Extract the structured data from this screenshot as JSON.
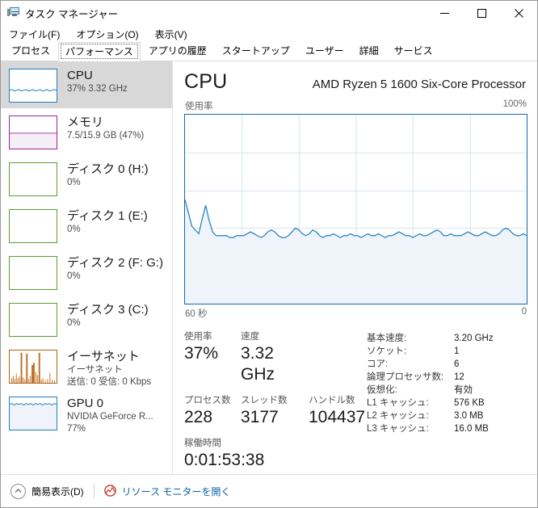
{
  "window": {
    "title": "タスク マネージャー",
    "icon": "task-manager-icon",
    "controls": {
      "minimize": "–",
      "maximize": "☐",
      "close": "✕"
    }
  },
  "menu": [
    {
      "label": "ファイル(F)",
      "name": "menu-file"
    },
    {
      "label": "オプション(O)",
      "name": "menu-options"
    },
    {
      "label": "表示(V)",
      "name": "menu-view"
    }
  ],
  "tabs": [
    {
      "label": "プロセス",
      "selected": false
    },
    {
      "label": "パフォーマンス",
      "selected": true
    },
    {
      "label": "アプリの履歴",
      "selected": false
    },
    {
      "label": "スタートアップ",
      "selected": false
    },
    {
      "label": "ユーザー",
      "selected": false
    },
    {
      "label": "詳細",
      "selected": false
    },
    {
      "label": "サービス",
      "selected": false
    }
  ],
  "sidebar": {
    "items": [
      {
        "title": "CPU",
        "sub1": "37%  3.32 GHz",
        "sub2": "",
        "selected": true,
        "color": "#1f7dc0"
      },
      {
        "title": "メモリ",
        "sub1": "7.5/15.9 GB (47%)",
        "sub2": "",
        "selected": false,
        "color": "#a020a0"
      },
      {
        "title": "ディスク 0 (H:)",
        "sub1": "0%",
        "sub2": "",
        "selected": false,
        "color": "#5a9e2f"
      },
      {
        "title": "ディスク 1 (E:)",
        "sub1": "0%",
        "sub2": "",
        "selected": false,
        "color": "#5a9e2f"
      },
      {
        "title": "ディスク 2 (F: G:)",
        "sub1": "0%",
        "sub2": "",
        "selected": false,
        "color": "#5a9e2f"
      },
      {
        "title": "ディスク 3 (C:)",
        "sub1": "0%",
        "sub2": "",
        "selected": false,
        "color": "#5a9e2f"
      },
      {
        "title": "イーサネット",
        "sub1": "イーサネット",
        "sub2": "送信: 0 受信: 0 Kbps",
        "selected": false,
        "color": "#b3631a"
      },
      {
        "title": "GPU 0",
        "sub1": "NVIDIA GeForce R...",
        "sub2": "77%",
        "selected": false,
        "color": "#1f7dc0"
      }
    ]
  },
  "main": {
    "title": "CPU",
    "subtitle": "AMD Ryzen 5 1600 Six-Core Processor",
    "graph_top_label": "使用率",
    "graph_max_label": "100%",
    "graph_left_label": "60 秒",
    "graph_right_label": "0",
    "stats": [
      {
        "label": "使用率",
        "value": "37%",
        "width": "w1"
      },
      {
        "label": "速度",
        "value": "3.32 GHz",
        "width": "w2"
      }
    ],
    "stats2": [
      {
        "label": "プロセス数",
        "value": "228",
        "width": "w1"
      },
      {
        "label": "スレッド数",
        "value": "3177",
        "width": "w2"
      },
      {
        "label": "ハンドル数",
        "value": "104437",
        "width": "w3"
      }
    ],
    "uptime": {
      "label": "稼働時間",
      "value": "0:01:53:38"
    },
    "specs": [
      {
        "key": "基本速度:",
        "value": "3.20 GHz"
      },
      {
        "key": "ソケット:",
        "value": "1"
      },
      {
        "key": "コア:",
        "value": "6"
      },
      {
        "key": "論理プロセッサ数:",
        "value": "12"
      },
      {
        "key": "仮想化:",
        "value": "有効"
      },
      {
        "key": "L1 キャッシュ:",
        "value": "576 KB"
      },
      {
        "key": "L2 キャッシュ:",
        "value": "3.0 MB"
      },
      {
        "key": "L3 キャッシュ:",
        "value": "16.0 MB"
      }
    ]
  },
  "statusbar": {
    "fewer_details": "簡易表示(D)",
    "resource_monitor": "リソース モニターを開く"
  },
  "colors": {
    "cpu_line": "#1f7dc0",
    "cpu_fill": "#eef4f9",
    "grid": "#d6e6f2",
    "border": "#0f6cb0",
    "link": "#0a5fa8",
    "selected_bg": "#d8d8d8"
  },
  "chart_data": {
    "type": "area",
    "title": "使用率",
    "ylabel": "",
    "xlabel": "",
    "ylim": [
      0,
      100
    ],
    "xlim": [
      60,
      0
    ],
    "x_axis_labels": [
      "60 秒",
      "0"
    ],
    "y_axis_labels": [
      "100%"
    ],
    "grid": true,
    "series": [
      {
        "name": "CPU 使用率 (%)",
        "values": [
          55,
          48,
          41,
          39,
          37,
          45,
          52,
          44,
          38,
          36,
          36,
          36,
          36,
          35,
          35,
          36,
          36,
          36,
          37,
          38,
          37,
          36,
          35,
          36,
          38,
          39,
          38,
          36,
          35,
          35,
          36,
          38,
          40,
          39,
          37,
          36,
          37,
          39,
          38,
          36,
          35,
          36,
          36,
          37,
          36,
          35,
          36,
          36,
          37,
          36,
          36,
          35,
          36,
          37,
          36,
          36,
          37,
          36,
          35,
          36,
          36,
          37,
          38,
          37,
          36,
          36,
          35,
          36,
          37,
          36,
          36,
          37,
          38,
          39,
          38,
          36,
          36,
          37,
          36,
          36,
          36,
          37,
          38,
          37,
          36,
          36,
          37,
          38,
          37,
          36,
          36,
          37,
          39,
          40,
          39,
          37,
          36,
          36,
          37,
          36
        ]
      }
    ]
  }
}
